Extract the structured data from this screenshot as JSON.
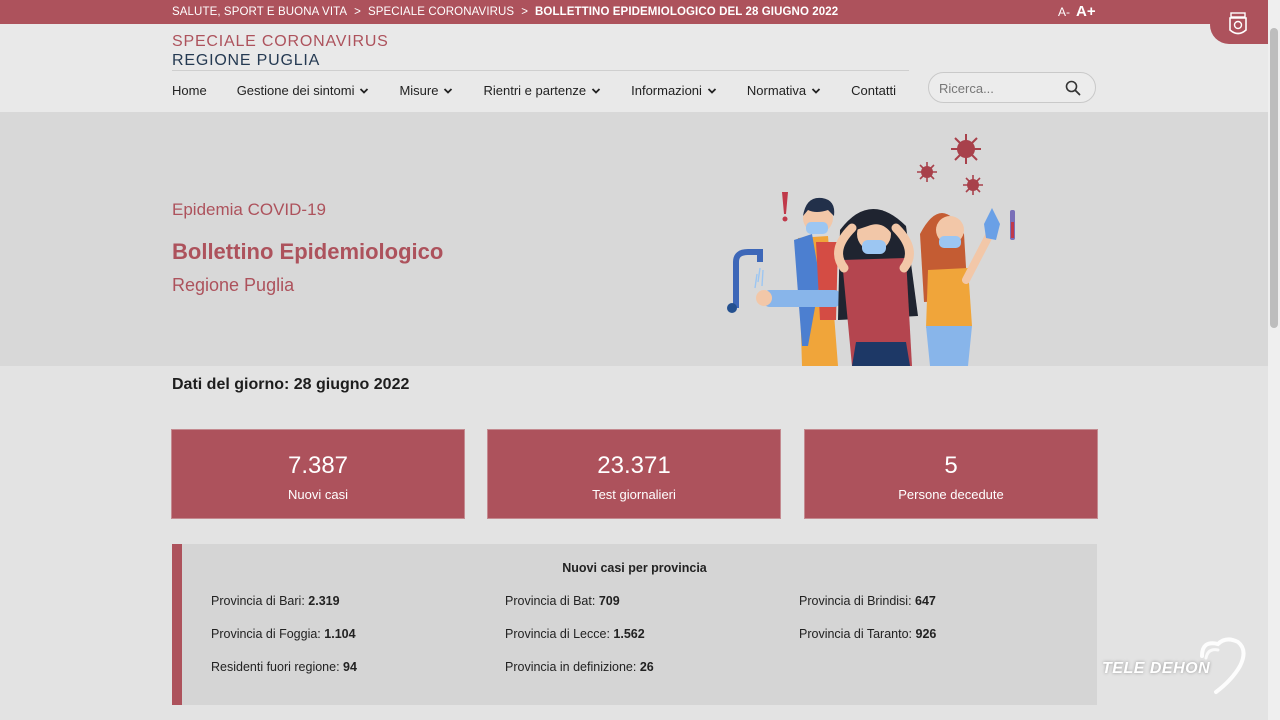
{
  "breadcrumb": {
    "items": [
      "SALUTE, SPORT E BUONA VITA",
      "SPECIALE CORONAVIRUS"
    ],
    "separator": ">",
    "current": "BOLLETTINO EPIDEMIOLOGICO DEL 28 GIUGNO 2022"
  },
  "font_controls": {
    "decrease": "A-",
    "increase": "A+"
  },
  "brand": {
    "line1": "SPECIALE CORONAVIRUS",
    "line2": "REGIONE PUGLIA"
  },
  "nav": {
    "items": [
      {
        "label": "Home"
      },
      {
        "label": "Gestione dei sintomi"
      },
      {
        "label": "Misure"
      },
      {
        "label": "Rientri e partenze"
      },
      {
        "label": "Informazioni"
      },
      {
        "label": "Normativa"
      },
      {
        "label": "Contatti"
      }
    ]
  },
  "search": {
    "placeholder": "Ricerca..."
  },
  "hero": {
    "eyebrow": "Epidemia COVID-19",
    "title": "Bollettino Epidemiologico",
    "subtitle": "Regione Puglia"
  },
  "date_label": "Dati del giorno: 28 giugno 2022",
  "stats": [
    {
      "value": "7.387",
      "label": "Nuovi casi"
    },
    {
      "value": "23.371",
      "label": "Test giornalieri"
    },
    {
      "value": "5",
      "label": "Persone decedute"
    }
  ],
  "provinces": {
    "title": "Nuovi casi per provincia",
    "rows": [
      {
        "label": "Provincia di Bari:",
        "value": "2.319"
      },
      {
        "label": "Provincia di Bat:",
        "value": "709"
      },
      {
        "label": "Provincia di Brindisi:",
        "value": "647"
      },
      {
        "label": "Provincia di Foggia:",
        "value": "1.104"
      },
      {
        "label": "Provincia di Lecce:",
        "value": "1.562"
      },
      {
        "label": "Provincia di Taranto:",
        "value": "926"
      },
      {
        "label": "Residenti fuori regione:",
        "value": "94"
      },
      {
        "label": "Provincia in definizione:",
        "value": "26"
      }
    ]
  },
  "watermark": {
    "text": "TELE DEHON"
  },
  "colors": {
    "accent": "#ad525c",
    "navy": "#253a52",
    "background": "#e3e3e3",
    "hero_bg": "#d8d8d8"
  }
}
